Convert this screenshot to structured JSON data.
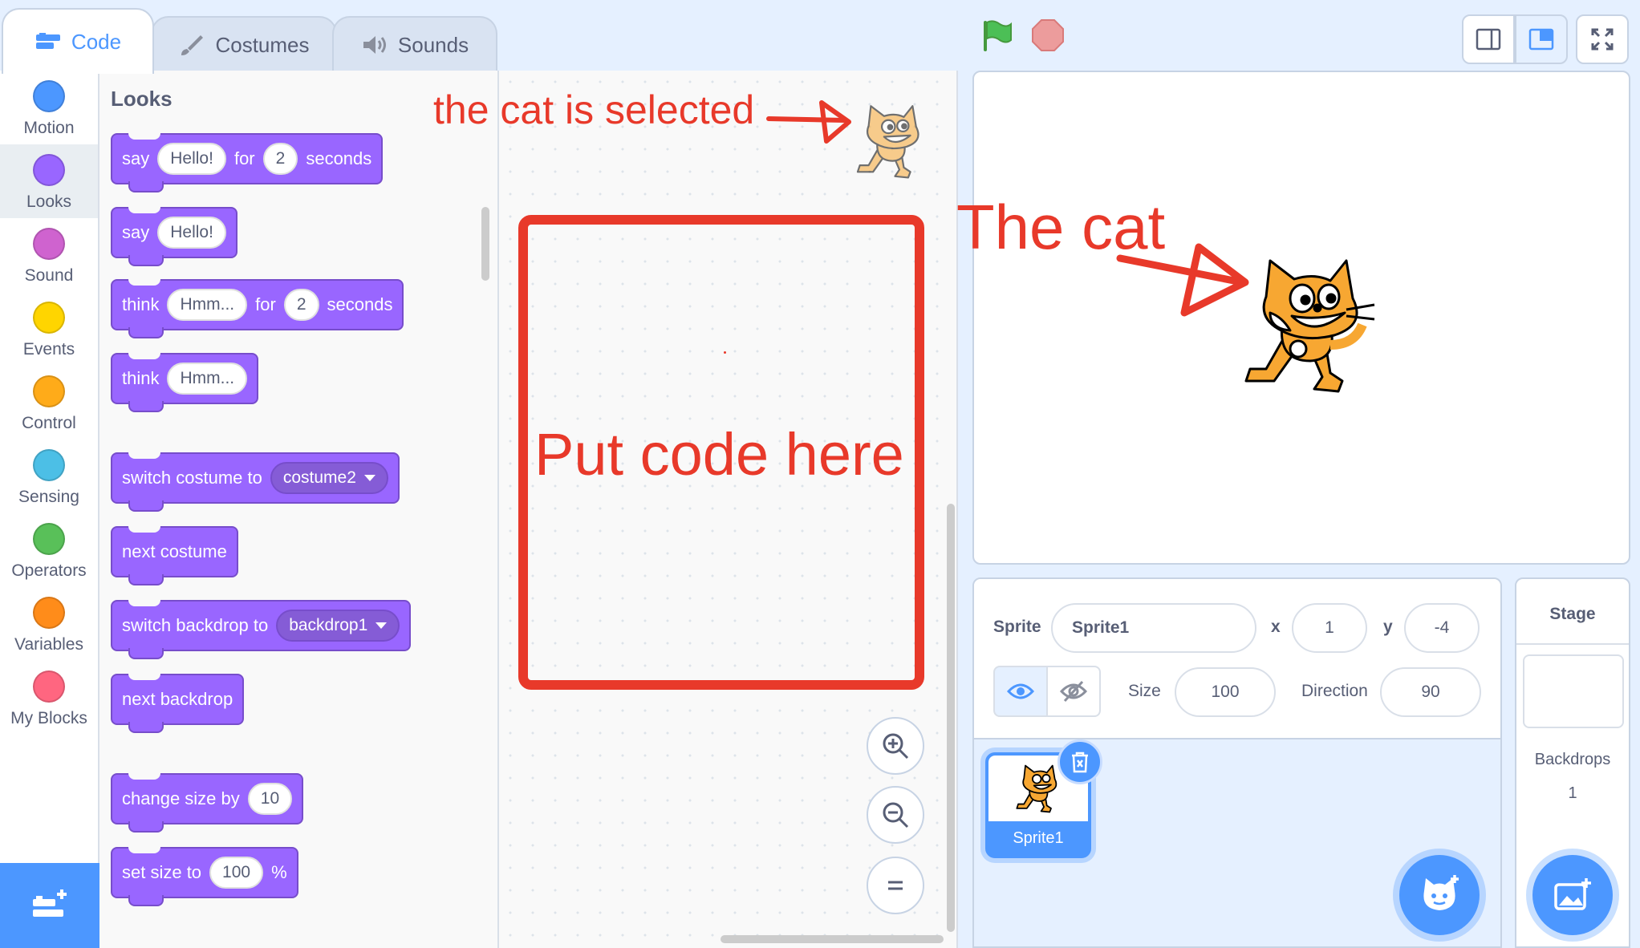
{
  "tabs": [
    {
      "label": "Code",
      "icon": "code-icon",
      "active": true
    },
    {
      "label": "Costumes",
      "icon": "brush-icon",
      "active": false
    },
    {
      "label": "Sounds",
      "icon": "speaker-icon",
      "active": false
    }
  ],
  "controls": {
    "green_flag": "green-flag-icon",
    "stop": "stop-icon"
  },
  "categories": [
    {
      "label": "Motion",
      "color": "#4c97ff"
    },
    {
      "label": "Looks",
      "color": "#9966ff"
    },
    {
      "label": "Sound",
      "color": "#cf63cf"
    },
    {
      "label": "Events",
      "color": "#ffd500"
    },
    {
      "label": "Control",
      "color": "#ffab19"
    },
    {
      "label": "Sensing",
      "color": "#4cbfe6"
    },
    {
      "label": "Operators",
      "color": "#59c059"
    },
    {
      "label": "Variables",
      "color": "#ff8c1a"
    },
    {
      "label": "My Blocks",
      "color": "#ff6680"
    }
  ],
  "palette": {
    "title": "Looks",
    "blocks": {
      "say_for": {
        "say": "say",
        "msg": "Hello!",
        "for": "for",
        "secs": "2",
        "seconds": "seconds"
      },
      "say": {
        "say": "say",
        "msg": "Hello!"
      },
      "think_for": {
        "think": "think",
        "msg": "Hmm...",
        "for": "for",
        "secs": "2",
        "seconds": "seconds"
      },
      "think": {
        "think": "think",
        "msg": "Hmm..."
      },
      "switch_costume": {
        "label": "switch costume to",
        "value": "costume2"
      },
      "next_costume": {
        "label": "next costume"
      },
      "switch_backdrop": {
        "label": "switch backdrop to",
        "value": "backdrop1"
      },
      "next_backdrop": {
        "label": "next backdrop"
      },
      "change_size": {
        "label": "change size by",
        "value": "10"
      },
      "set_size": {
        "label": "set size to",
        "value": "100",
        "unit": "%"
      }
    }
  },
  "annotations": {
    "selected": "the cat is selected",
    "cat": "The cat",
    "put_code": "Put code here"
  },
  "sprite_info": {
    "sprite_label": "Sprite",
    "sprite_name": "Sprite1",
    "x_label": "x",
    "x": "1",
    "y_label": "y",
    "y": "-4",
    "size_label": "Size",
    "size": "100",
    "direction_label": "Direction",
    "direction": "90"
  },
  "sprites": [
    {
      "name": "Sprite1",
      "selected": true
    }
  ],
  "stage_pane": {
    "title": "Stage",
    "backdrops_label": "Backdrops",
    "backdrops_count": "1"
  },
  "colors": {
    "accent": "#4c97ff",
    "looks": "#9966ff",
    "annotation": "#e8392a"
  }
}
